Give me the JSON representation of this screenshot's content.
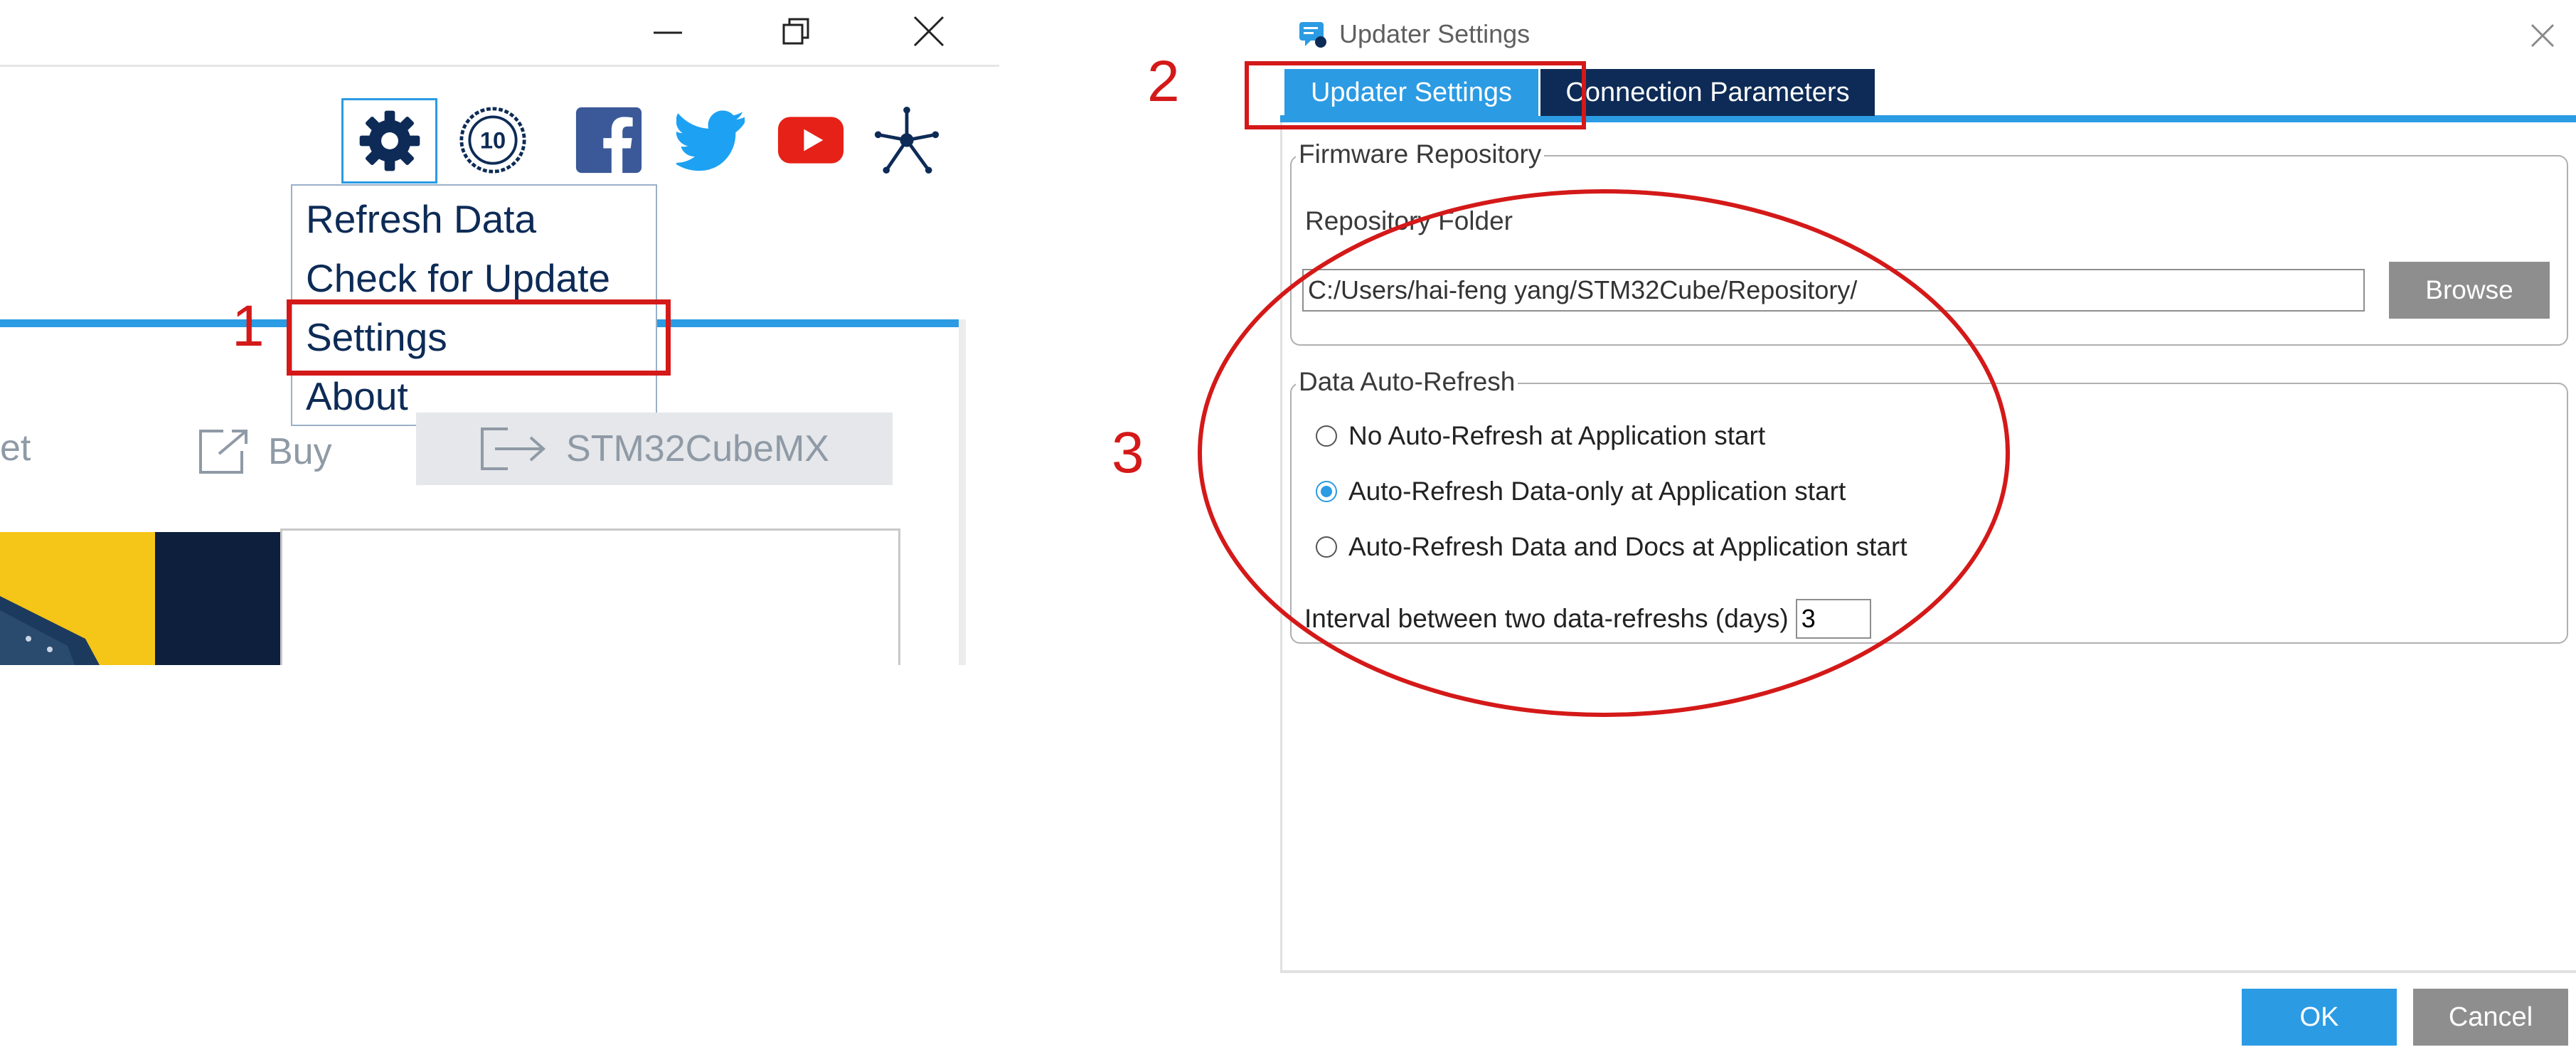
{
  "left_window": {
    "controls": {
      "minimize": "minimize-icon",
      "maximize": "restore-icon",
      "close": "close-icon"
    },
    "toolbar_icons": [
      "gear-icon",
      "anniversary-10-icon",
      "facebook-icon",
      "twitter-icon",
      "youtube-icon",
      "network-icon"
    ],
    "menu": {
      "items": [
        {
          "label": "Refresh Data"
        },
        {
          "label": "Check for Update"
        },
        {
          "label": "Settings"
        },
        {
          "label": "About"
        }
      ]
    },
    "tabs": {
      "partial_label": "et",
      "buy_label": "Buy",
      "cubemx_label": "STM32CubeMX"
    }
  },
  "dialog": {
    "title": "Updater Settings",
    "tabs": [
      {
        "label": "Updater Settings",
        "active": true
      },
      {
        "label": "Connection Parameters",
        "active": false
      }
    ],
    "firmware": {
      "group_title": "Firmware Repository",
      "folder_label": "Repository Folder",
      "folder_value": "C:/Users/hai-feng yang/STM32Cube/Repository/",
      "browse_label": "Browse"
    },
    "refresh": {
      "group_title": "Data Auto-Refresh",
      "options": [
        {
          "label": "No Auto-Refresh at Application start",
          "selected": false
        },
        {
          "label": "Auto-Refresh Data-only at Application start",
          "selected": true
        },
        {
          "label": "Auto-Refresh Data and Docs at Application start",
          "selected": false
        }
      ],
      "interval_label": "Interval between two data-refreshs (days)",
      "interval_value": "3"
    },
    "ok_label": "OK",
    "cancel_label": "Cancel"
  },
  "annotations": {
    "step1": "1",
    "step2": "2",
    "step3": "3"
  },
  "colors": {
    "accent_blue": "#2b9be3",
    "navy": "#0d2b56",
    "annotation_red": "#d41919",
    "button_gray": "#8e8e8e"
  }
}
